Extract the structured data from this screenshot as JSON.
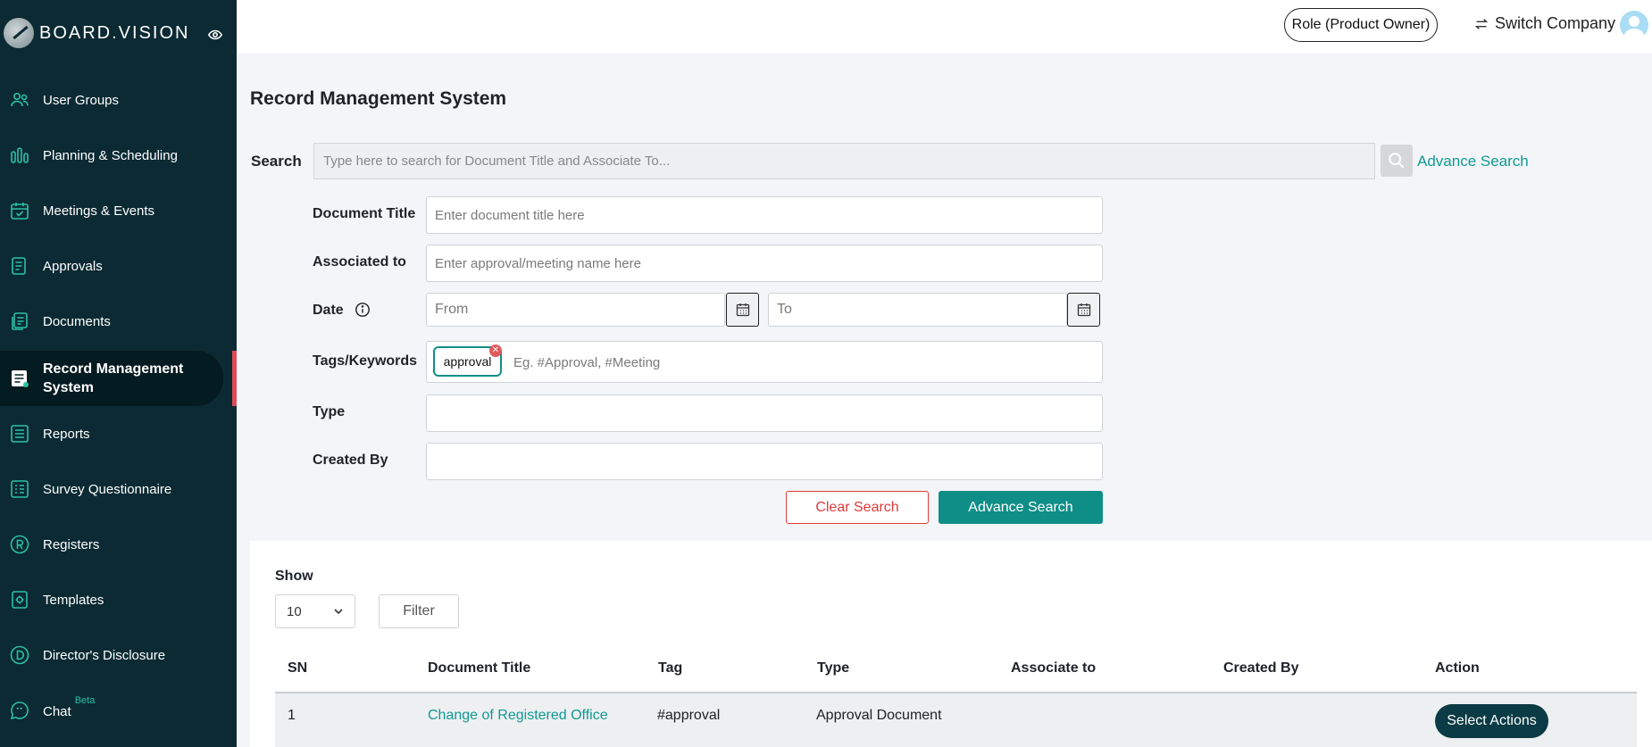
{
  "app": {
    "logo_text": "BOARD.VISION"
  },
  "sidebar": {
    "items": [
      {
        "label": "User Groups",
        "icon": "users-icon"
      },
      {
        "label": "Planning & Scheduling",
        "icon": "bars-icon"
      },
      {
        "label": "Meetings & Events",
        "icon": "calendar-check-icon"
      },
      {
        "label": "Approvals",
        "icon": "document-icon"
      },
      {
        "label": "Documents",
        "icon": "documents-icon"
      },
      {
        "label": "Record Management System",
        "icon": "records-icon",
        "active": true
      },
      {
        "label": "Reports",
        "icon": "list-icon"
      },
      {
        "label": "Survey Questionnaire",
        "icon": "survey-icon"
      },
      {
        "label": "Registers",
        "icon": "registered-icon"
      },
      {
        "label": "Templates",
        "icon": "template-icon"
      },
      {
        "label": "Director's Disclosure",
        "icon": "disclosure-icon"
      },
      {
        "label": "Chat",
        "icon": "chat-icon",
        "badge": "Beta"
      }
    ]
  },
  "topbar": {
    "role_label": "Role (Product Owner)",
    "switch_label": "Switch Company"
  },
  "page": {
    "title": "Record Management System"
  },
  "search": {
    "label": "Search",
    "placeholder": "Type here to search for Document Title and Associate To...",
    "advance_link": "Advance Search"
  },
  "form": {
    "document_title": {
      "label": "Document Title",
      "placeholder": "Enter document title here"
    },
    "associated_to": {
      "label": "Associated to",
      "placeholder": "Enter approval/meeting name here"
    },
    "date": {
      "label": "Date",
      "from_placeholder": "From",
      "to_placeholder": "To"
    },
    "tags": {
      "label": "Tags/Keywords",
      "chip": "approval",
      "placeholder": "Eg. #Approval, #Meeting"
    },
    "type": {
      "label": "Type"
    },
    "created_by": {
      "label": "Created By"
    },
    "clear_button": "Clear Search",
    "advance_button": "Advance Search"
  },
  "table": {
    "show_label": "Show",
    "page_size": "10",
    "filter_button": "Filter",
    "headers": [
      "SN",
      "Document Title",
      "Tag",
      "Type",
      "Associate to",
      "Created By",
      "Action"
    ],
    "rows": [
      {
        "sn": "1",
        "title": "Change of Registered Office",
        "tag": "#approval",
        "type": "Approval Document",
        "associate_to": "",
        "created_by": "",
        "action": "Select Actions"
      }
    ]
  },
  "colors": {
    "sidebar": "#0b2a33",
    "accent": "#0f8e87",
    "danger": "#e03a3a",
    "active_marker": "#e04a54"
  }
}
